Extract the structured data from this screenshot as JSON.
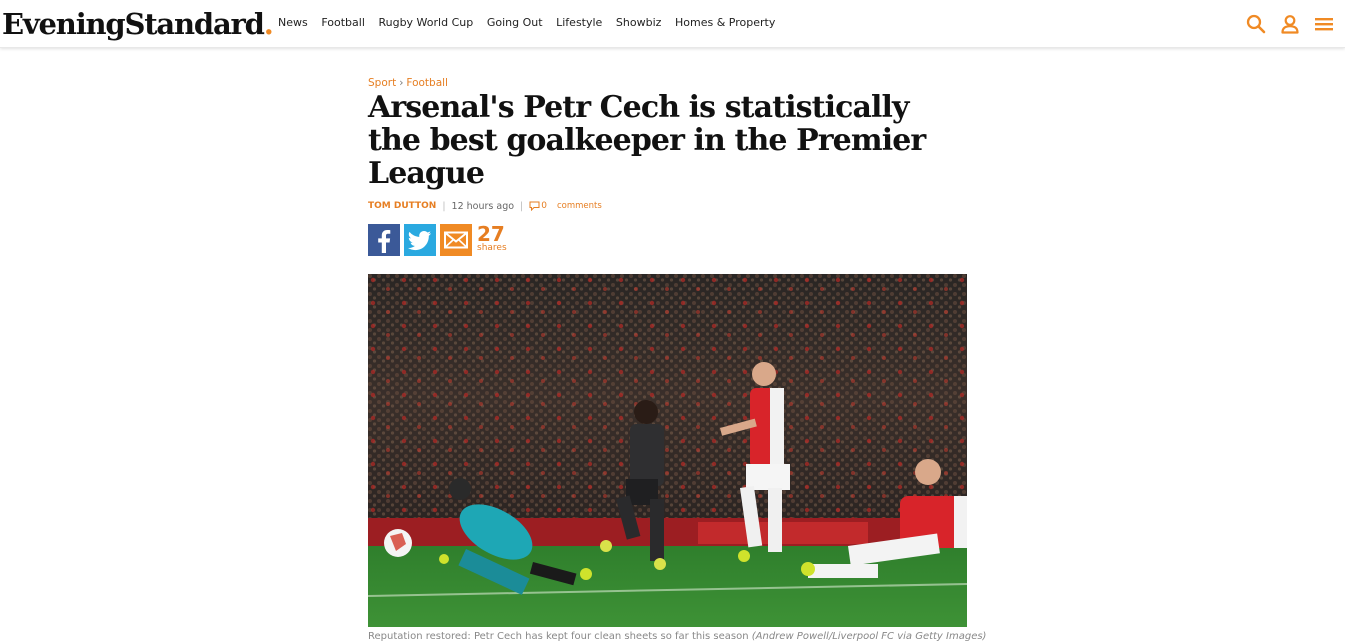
{
  "site": {
    "logo": "EveningStandard",
    "logo_dot": ".",
    "brand_color": "#f08a24"
  },
  "nav": [
    "News",
    "Football",
    "Rugby World Cup",
    "Going Out",
    "Lifestyle",
    "Showbiz",
    "Homes & Property"
  ],
  "header_icons": [
    "search-icon",
    "user-icon",
    "menu-icon"
  ],
  "article": {
    "breadcrumb": [
      "Sport",
      "Football"
    ],
    "breadcrumb_separator": "›",
    "headline": "Arsenal's Petr Cech is statistically the best goalkeeper in the Premier League",
    "author": "TOM DUTTON",
    "time": "12 hours  ago",
    "comments_count": "0",
    "comments_label": "comments",
    "share_buttons": [
      "facebook-icon",
      "twitter-icon",
      "email-icon"
    ],
    "share_count": "27",
    "share_label": "shares",
    "caption": "Reputation restored: Petr Cech has kept four clean sheets so far this season",
    "caption_credit": "(Andrew Powell/Liverpool FC via Getty Images)"
  }
}
